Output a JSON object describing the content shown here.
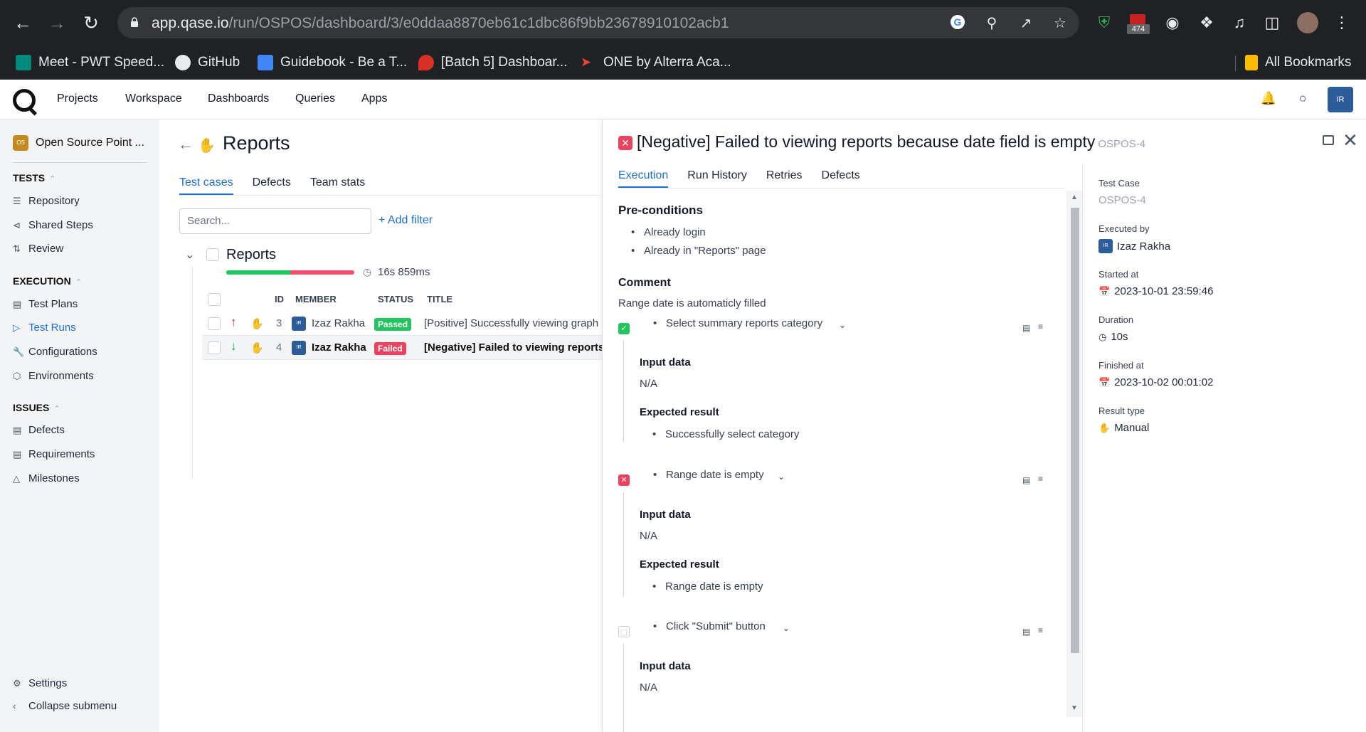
{
  "browser": {
    "url_host": "app.qase.io",
    "url_path": "/run/OSPOS/dashboard/3/e0ddaa8870eb61c1dbc86f9bb23678910102acb1",
    "ext_badge": "474",
    "bookmarks": [
      {
        "label": "Meet - PWT Speed...",
        "icon": "google-meet-icon"
      },
      {
        "label": "GitHub",
        "icon": "github-icon"
      },
      {
        "label": "Guidebook - Be a T...",
        "icon": "google-docs-icon"
      },
      {
        "label": "[Batch 5] Dashboar...",
        "icon": "pin-icon"
      },
      {
        "label": "ONE by Alterra Aca...",
        "icon": "alterra-icon"
      }
    ],
    "all_bookmarks": "All Bookmarks"
  },
  "header": {
    "nav": [
      "Projects",
      "Workspace",
      "Dashboards",
      "Queries",
      "Apps"
    ],
    "avatar": "IR"
  },
  "sidebar": {
    "project": "Open Source Point ...",
    "project_pic": "OS",
    "tests_heading": "TESTS",
    "tests_items": [
      "Repository",
      "Shared Steps",
      "Review"
    ],
    "execution_heading": "EXECUTION",
    "execution_items": [
      "Test Plans",
      "Test Runs",
      "Configurations",
      "Environments"
    ],
    "issues_heading": "ISSUES",
    "issues_items": [
      "Defects",
      "Requirements",
      "Milestones"
    ],
    "settings": "Settings",
    "collapse": "Collapse submenu"
  },
  "main": {
    "title": "Reports",
    "tabs": [
      "Test cases",
      "Defects",
      "Team stats"
    ],
    "search_placeholder": "Search...",
    "add_filter": "+ Add filter",
    "suite": "Reports",
    "duration": "16s 859ms",
    "passed_fraction": 0.5,
    "columns": [
      "ID",
      "MEMBER",
      "STATUS",
      "TITLE"
    ],
    "rows": [
      {
        "id": "3",
        "member": "Izaz Rakha",
        "status": "Passed",
        "title": "[Positive] Successfully viewing graph"
      },
      {
        "id": "4",
        "member": "Izaz Rakha",
        "status": "Failed",
        "title": "[Negative] Failed to viewing reports"
      }
    ]
  },
  "panel": {
    "title": "[Negative] Failed to viewing reports because date field is empty",
    "code": "OSPOS-4",
    "tabs": [
      "Execution",
      "Run History",
      "Retries",
      "Defects"
    ],
    "preconditions_heading": "Pre-conditions",
    "preconditions": [
      "Already login",
      "Already in \"Reports\" page"
    ],
    "comment_heading": "Comment",
    "comment": "Range date is automaticly filled",
    "input_label": "Input data",
    "expected_label": "Expected result",
    "steps": [
      {
        "action": "Select summary reports category",
        "status": "passed",
        "input": "N/A",
        "expected": "Successfully select category"
      },
      {
        "action": "Range date is empty",
        "status": "failed",
        "input": "N/A",
        "expected": "Range date is empty"
      },
      {
        "action": "Click \"Submit\" button",
        "status": "skipped",
        "input": "N/A"
      }
    ],
    "details": {
      "test_case_label": "Test Case",
      "test_case": "OSPOS-4",
      "executed_by_label": "Executed by",
      "executed_by": "Izaz Rakha",
      "started_label": "Started at",
      "started": "2023-10-01 23:59:46",
      "duration_label": "Duration",
      "duration": "10s",
      "finished_label": "Finished at",
      "finished": "2023-10-02 00:01:02",
      "result_type_label": "Result type",
      "result_type": "Manual"
    }
  },
  "colors": {
    "accent": "#1d6fd6",
    "passed": "#22c55e",
    "failed": "#ef4060",
    "chrome": "#202124"
  }
}
